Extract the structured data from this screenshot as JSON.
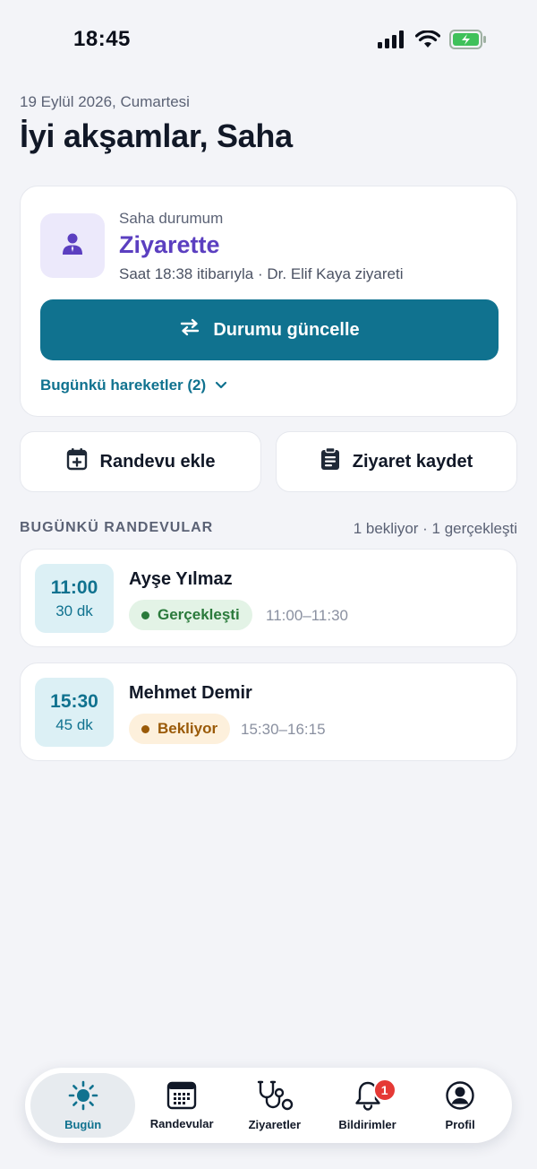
{
  "status_bar": {
    "time": "18:45"
  },
  "header": {
    "date": "19 Eylül 2026, Cumartesi",
    "greeting": "İyi akşamlar, Saha"
  },
  "field_status": {
    "label": "Saha durumum",
    "value": "Ziyarette",
    "meta": "Saat 18:38 itibarıyla · Dr. Elif Kaya ziyareti",
    "update_button": "Durumu güncelle",
    "moves_link": "Bugünkü hareketler (2)"
  },
  "quick_actions": {
    "add_appointment": "Randevu ekle",
    "record_visit": "Ziyaret kaydet"
  },
  "appointments_section": {
    "title": "BUGÜNKÜ RANDEVULAR",
    "summary": "1 bekliyor · 1 gerçekleşti"
  },
  "appointments": [
    {
      "time": "11:00",
      "duration": "30 dk",
      "name": "Ayşe Yılmaz",
      "status": "Gerçekleşti",
      "range": "11:00–11:30"
    },
    {
      "time": "15:30",
      "duration": "45 dk",
      "name": "Mehmet Demir",
      "status": "Bekliyor",
      "range": "15:30–16:15"
    }
  ],
  "tabs": [
    {
      "label": "Bugün",
      "icon": "sun-icon"
    },
    {
      "label": "Randevular",
      "icon": "calendar-icon"
    },
    {
      "label": "Ziyaretler",
      "icon": "stethoscope-icon"
    },
    {
      "label": "Bildirimler",
      "icon": "bell-icon",
      "badge": "1"
    },
    {
      "label": "Profil",
      "icon": "profile-icon"
    }
  ],
  "colors": {
    "primary": "#10728f",
    "status_purple": "#5b3fc0",
    "done_green": "#2a7a3b",
    "waiting_orange": "#9a5a08",
    "badge_red": "#e53935",
    "background": "#f3f4f8"
  }
}
